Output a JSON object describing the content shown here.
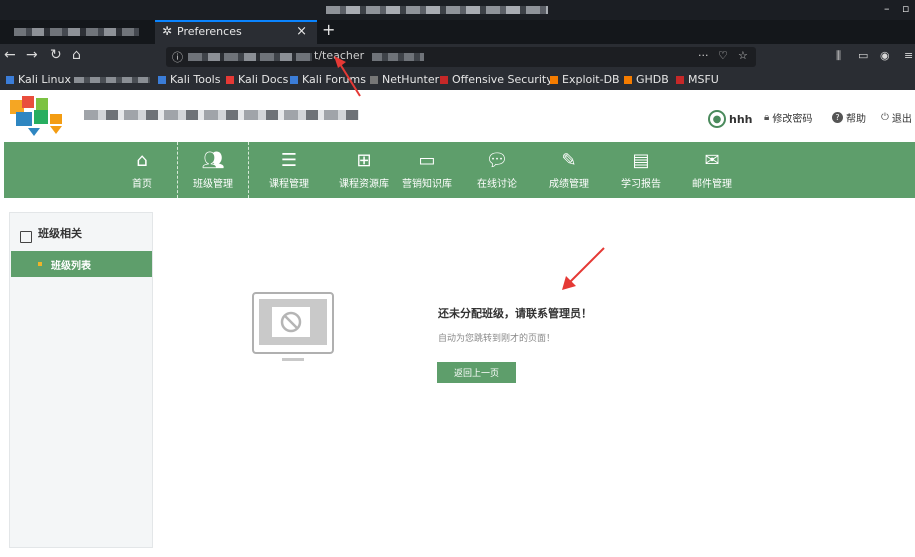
{
  "browser": {
    "tab_title": "Preferences",
    "tab_close": "×",
    "new_tab": "+",
    "url_visible": "t/teacher",
    "url_actions": "···",
    "minimize": "–",
    "maximize": "▫",
    "bookmarks": [
      {
        "label": "Kali Linux",
        "color": "#3b7dd8"
      },
      {
        "label": "Kali Tools",
        "color": "#3b7dd8"
      },
      {
        "label": "Kali Docs",
        "color": "#e53935"
      },
      {
        "label": "Kali Forums",
        "color": "#3b7dd8"
      },
      {
        "label": "NetHunter",
        "color": "#2a2d33"
      },
      {
        "label": "Offensive Security",
        "color": "#c62828"
      },
      {
        "label": "Exploit-DB",
        "color": "#f57c00"
      },
      {
        "label": "GHDB",
        "color": "#f57c00"
      },
      {
        "label": "MSFU",
        "color": "#c62828"
      }
    ]
  },
  "header": {
    "user_name": "hhh",
    "change_password": "修改密码",
    "help": "帮助",
    "logout": "退出"
  },
  "nav": {
    "items": [
      {
        "label": "首页",
        "icon": "home-icon"
      },
      {
        "label": "班级管理",
        "icon": "users-icon"
      },
      {
        "label": "课程管理",
        "icon": "list-icon"
      },
      {
        "label": "课程资源库",
        "icon": "sitemap-icon"
      },
      {
        "label": "营销知识库",
        "icon": "inbox-icon"
      },
      {
        "label": "在线讨论",
        "icon": "chat-icon"
      },
      {
        "label": "成绩管理",
        "icon": "pen-icon"
      },
      {
        "label": "学习报告",
        "icon": "report-icon"
      },
      {
        "label": "邮件管理",
        "icon": "mail-icon"
      }
    ],
    "active_index": 1
  },
  "sidebar": {
    "section_title": "班级相关",
    "items": [
      {
        "label": "班级列表"
      }
    ]
  },
  "main": {
    "message_title": "还未分配班级，请联系管理员！",
    "message_sub": "自动为您跳转到刚才的页面！",
    "back_button": "返回上一页"
  },
  "colors": {
    "accent_green": "#5e9e6b",
    "annotation_red": "#e53935"
  }
}
